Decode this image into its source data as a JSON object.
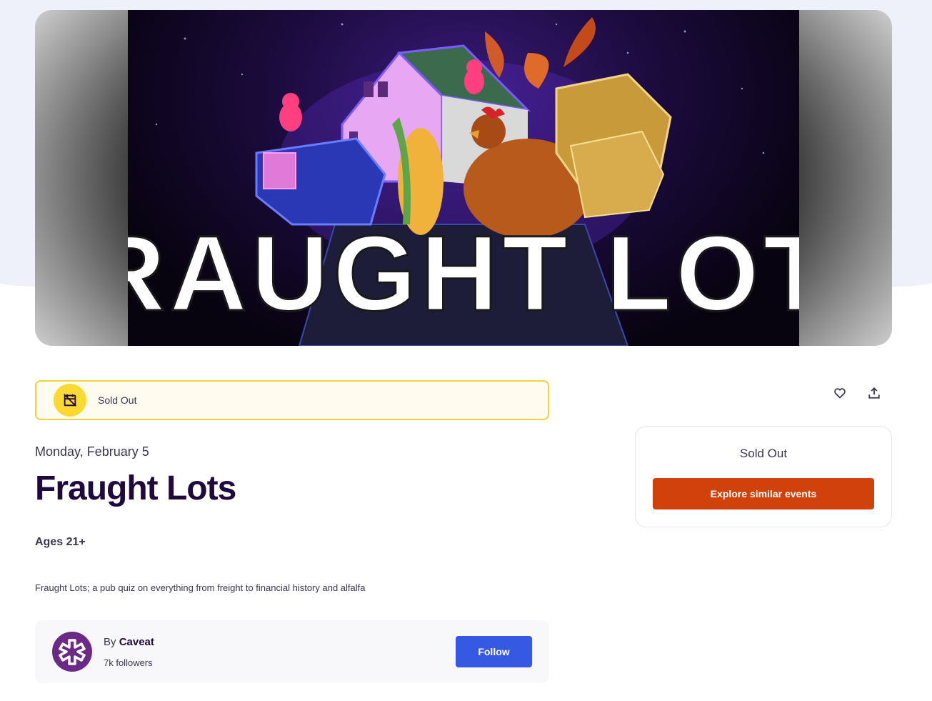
{
  "hero": {
    "image_alt": "Fraught Lots event banner",
    "banner_text": "FRAUGHT LOTS"
  },
  "status_banner": {
    "label": "Sold Out",
    "icon": "calendar-off-icon",
    "accent": "#f9d932"
  },
  "actions": {
    "like_icon": "heart-icon",
    "share_icon": "share-icon"
  },
  "event": {
    "date": "Monday, February 5",
    "title": "Fraught Lots",
    "ages": "Ages 21+",
    "description": "Fraught Lots; a pub quiz on everything from freight to financial history and alfalfa"
  },
  "organizer": {
    "by_prefix": "By",
    "name": "Caveat",
    "followers": "7k followers",
    "follow_label": "Follow",
    "avatar_color": "#6a2a86"
  },
  "ticket": {
    "status": "Sold Out",
    "explore_label": "Explore similar events",
    "button_color": "#d1410c"
  },
  "colors": {
    "follow_button": "#3659e3",
    "title": "#1e0a3c"
  }
}
